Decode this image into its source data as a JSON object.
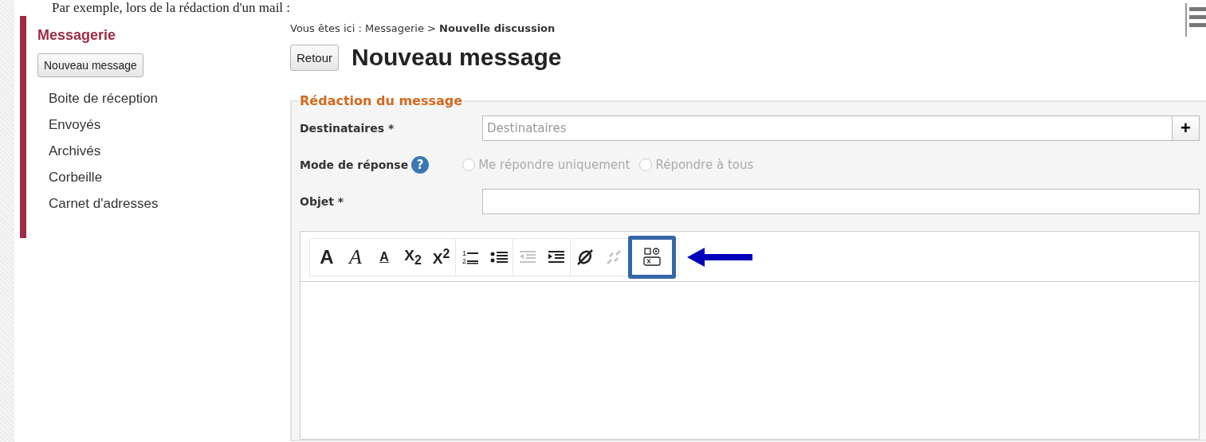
{
  "intro_text": "Par exemple, lors de la rédaction d'un mail :",
  "sidebar": {
    "title": "Messagerie",
    "new_button": "Nouveau message",
    "items": [
      {
        "label": "Boite de réception"
      },
      {
        "label": "Envoyés"
      },
      {
        "label": "Archivés"
      },
      {
        "label": "Corbeille"
      },
      {
        "label": "Carnet d'adresses"
      }
    ]
  },
  "breadcrumb": {
    "prefix": "Vous êtes ici : Messagerie > ",
    "current": "Nouvelle discussion"
  },
  "back_button": "Retour",
  "page_title": "Nouveau message",
  "form": {
    "legend": "Rédaction du message",
    "recipients": {
      "label": "Destinataires *",
      "placeholder": "Destinataires",
      "add": "+"
    },
    "reply_mode": {
      "label": "Mode de réponse",
      "help": "?",
      "options": [
        {
          "label": "Me répondre uniquement",
          "checked": false,
          "disabled": true
        },
        {
          "label": "Répondre à tous",
          "checked": false,
          "disabled": true
        }
      ]
    },
    "subject": {
      "label": "Objet *"
    }
  },
  "toolbar": [
    {
      "kind": "bold",
      "label": "A",
      "disabled": false,
      "highlighted": false,
      "group_end": false
    },
    {
      "kind": "italic",
      "label": "A",
      "disabled": false,
      "highlighted": false,
      "group_end": false
    },
    {
      "kind": "underline",
      "label": "A",
      "disabled": false,
      "highlighted": false,
      "group_end": false
    },
    {
      "kind": "subscript",
      "label": "X$_{2}$",
      "disabled": false,
      "highlighted": false,
      "group_end": false
    },
    {
      "kind": "superscript",
      "label": "X$^{2}$",
      "disabled": false,
      "highlighted": false,
      "group_end": true
    },
    {
      "kind": "ordered-list",
      "label": "1\n2",
      "disabled": false,
      "highlighted": false,
      "group_end": false
    },
    {
      "kind": "bullet-list",
      "disabled": false,
      "highlighted": false,
      "group_end": true
    },
    {
      "kind": "outdent",
      "disabled": true,
      "highlighted": false,
      "group_end": false
    },
    {
      "kind": "indent",
      "disabled": false,
      "highlighted": false,
      "group_end": true
    },
    {
      "kind": "link",
      "disabled": false,
      "highlighted": false,
      "group_end": false
    },
    {
      "kind": "unlink",
      "disabled": true,
      "highlighted": false,
      "group_end": false
    },
    {
      "kind": "formula",
      "disabled": false,
      "highlighted": true,
      "group_end": false
    }
  ]
}
